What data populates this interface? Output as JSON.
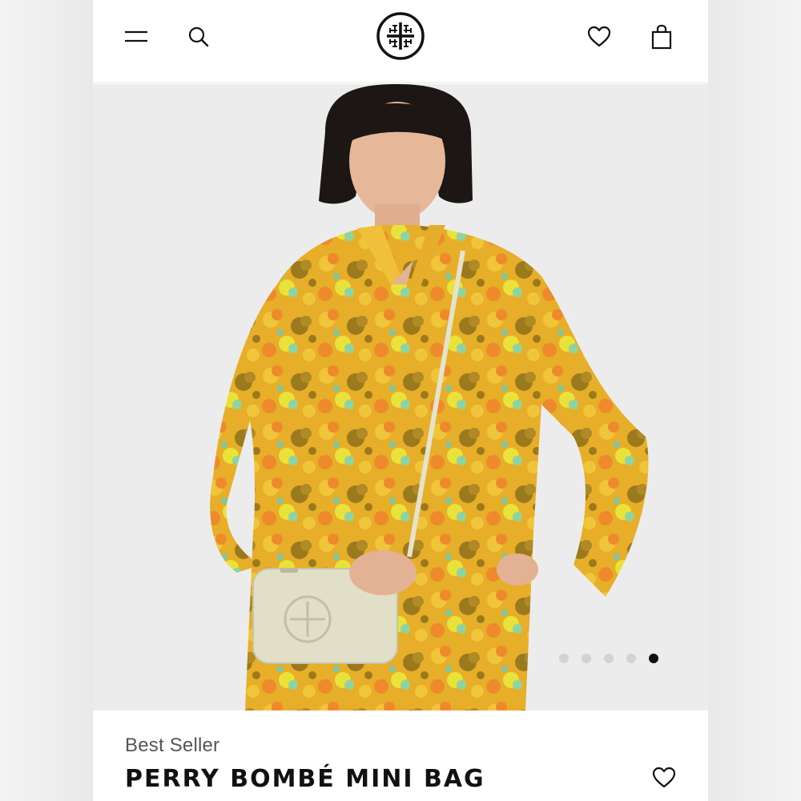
{
  "header": {
    "menu_icon": "hamburger-menu-icon",
    "search_icon": "search-icon",
    "logo": "tory-burch-logo",
    "wishlist_icon": "heart-icon",
    "bag_icon": "shopping-bag-icon"
  },
  "gallery": {
    "image": "model-in-floral-outfit-with-crossbody-bag",
    "slide_count": 5,
    "active_slide": 5
  },
  "product": {
    "badge": "Best Seller",
    "title": "PERRY BOMBÉ MINI BAG",
    "wishlist_icon": "heart-icon"
  },
  "colors": {
    "accent": "#111111",
    "dot_inactive": "#d3d3d3",
    "background": "#ffffff"
  }
}
